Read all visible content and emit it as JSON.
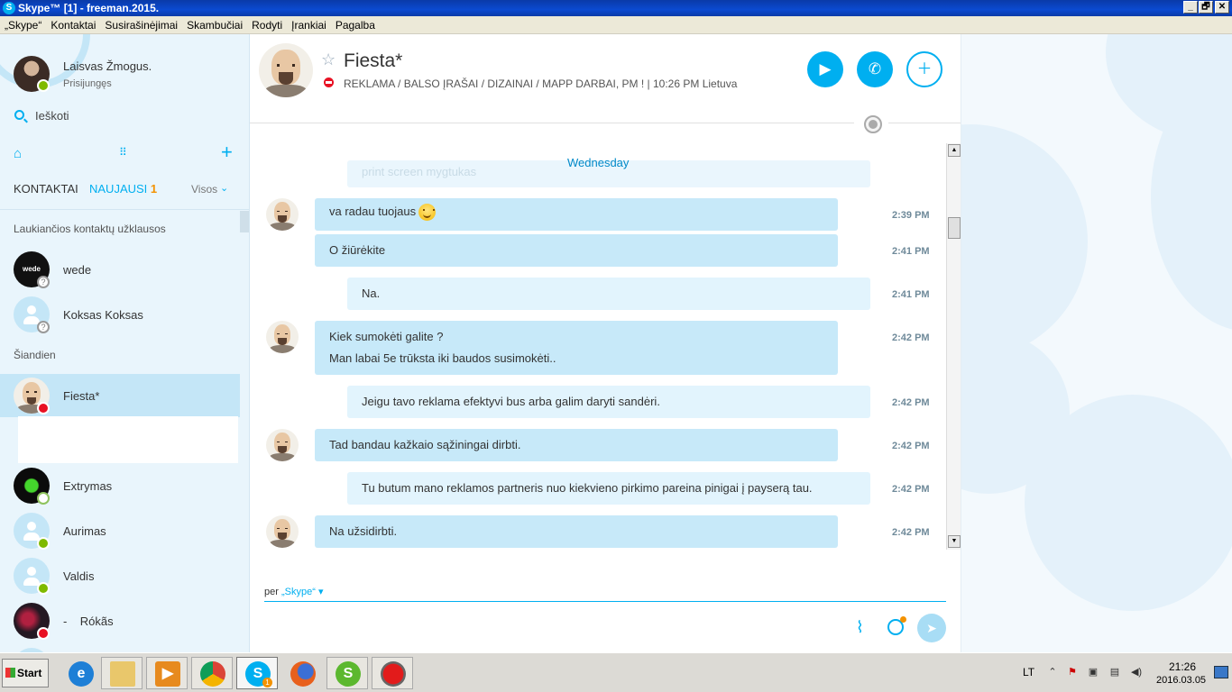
{
  "window": {
    "title": "Skype™ [1] - freeman.2015.",
    "app_icon": "skype-icon",
    "buttons": [
      "_",
      "🗗",
      "✕"
    ]
  },
  "menu": [
    "„Skype“",
    "Kontaktai",
    "Susirašinėjimai",
    "Skambučiai",
    "Rodyti",
    "Įrankiai",
    "Pagalba"
  ],
  "sidebar": {
    "me": {
      "name": "Laisvas Žmogus.",
      "status": "Prisijungęs"
    },
    "search_label": "Ieškoti",
    "tabs": {
      "contacts": "KONTAKTAI",
      "recent": "NAUJAUSI",
      "recent_count": "1",
      "filter": "Visos"
    },
    "sections": {
      "pending": "Laukiančios kontaktų užklausos",
      "today": "Šiandien"
    },
    "contacts": [
      {
        "name": "wede",
        "status": "pending"
      },
      {
        "name": "Koksas Koksas",
        "status": "pending"
      },
      {
        "name": "Fiesta*",
        "status": "do-not-disturb"
      },
      {
        "name": "Extrymas",
        "status": "offline"
      },
      {
        "name": "Aurimas",
        "status": "online"
      },
      {
        "name": "Valdis",
        "status": "online"
      },
      {
        "name": "-    Rókãs",
        "status": "do-not-disturb"
      }
    ],
    "avatar_labels": {
      "wede": "wede"
    }
  },
  "conversation": {
    "name": "Fiesta*",
    "mood": "REKLAMA / BALSO ĮRAŠAI / DIZAINAI / MAPP DARBAI, PM !  |  10:26 PM Lietuva",
    "day_separator": "Wednesday",
    "ghost_message": "print screen mygtukas",
    "messages": [
      {
        "from": "them",
        "lines": [
          "va radau tuojaus"
        ],
        "emoji": "smiley",
        "time": "2:39 PM"
      },
      {
        "from": "them",
        "lines": [
          "O žiūrėkite"
        ],
        "time": "2:41 PM"
      },
      {
        "from": "me",
        "lines": [
          "Na."
        ],
        "time": "2:41 PM"
      },
      {
        "from": "them",
        "lines": [
          "Kiek sumokėti galite ?",
          "Man labai 5e trūksta iki baudos susimokėti.."
        ],
        "time": "2:42 PM"
      },
      {
        "from": "me",
        "lines": [
          "Jeigu tavo reklama efektyvi bus arba galim daryti sandėri."
        ],
        "time": "2:42 PM"
      },
      {
        "from": "them",
        "lines": [
          "Tad bandau kažkaio sąžiningai dirbti."
        ],
        "time": "2:42 PM"
      },
      {
        "from": "me",
        "lines": [
          "Tu butum mano reklamos partneris nuo kiekvieno pirkimo pareina pinigai į payserą tau."
        ],
        "time": "2:42 PM"
      },
      {
        "from": "them",
        "lines": [
          "Na užsidirbti."
        ],
        "time": "2:42 PM"
      }
    ],
    "composer": {
      "via_label": "per",
      "via_link": "„Skype“",
      "placeholder": ""
    }
  },
  "taskbar": {
    "start_label": "Start",
    "apps": [
      "internet-explorer",
      "file-explorer",
      "media-player",
      "chrome",
      "skype",
      "firefox",
      "skype-green",
      "record"
    ],
    "skype_badge": "1",
    "language": "LT",
    "time": "21:26",
    "date": "2016.03.05"
  },
  "colors": {
    "accent": "#00aff0",
    "bubble_them": "#c7e9f9",
    "bubble_me": "#e2f4fd",
    "dnd": "#e81123",
    "online": "#7fba00",
    "badge": "#f39200"
  }
}
